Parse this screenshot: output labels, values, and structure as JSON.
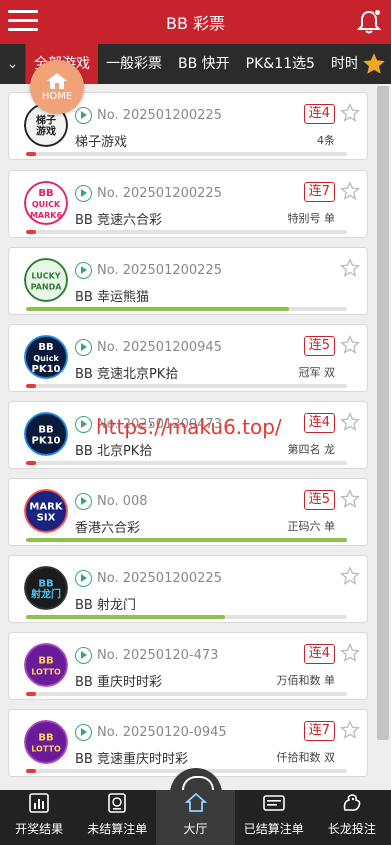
{
  "header": {
    "title": "BB 彩票"
  },
  "categories": [
    "全部游戏",
    "一般彩票",
    "BB 快开",
    "PK&11选5",
    "时时彩"
  ],
  "home": {
    "label": "HOME"
  },
  "watermark": "https://maku6.top/",
  "colors": {
    "brand": "#c8232c",
    "progress_green": "#8bc34a",
    "progress_red": "#e53935"
  },
  "lotteries": [
    {
      "issue": "No. 202501200225",
      "name": "梯子游戏",
      "streak": "连4",
      "result": "4条",
      "progress": 0.03,
      "progress_color": "#e53935",
      "logo": "ladder-game-logo",
      "logo_text": [
        "梯子",
        "游戏"
      ]
    },
    {
      "issue": "No. 202501200225",
      "name": "BB 竞速六合彩",
      "streak": "连7",
      "result": "特别号 单",
      "progress": 0.03,
      "progress_color": "#e53935",
      "logo": "quick-mark6-logo",
      "logo_text": [
        "BB",
        "QUICK",
        "MARK6"
      ]
    },
    {
      "issue": "No. 202501200225",
      "name": "BB 幸运熊猫",
      "streak": "",
      "result": "",
      "progress": 0.82,
      "progress_color": "#8bc34a",
      "logo": "lucky-panda-logo",
      "logo_text": [
        "LUCKY",
        "PANDA"
      ]
    },
    {
      "issue": "No. 202501200945",
      "name": "BB 竞速北京PK拾",
      "streak": "连5",
      "result": "冠军 双",
      "progress": 0.03,
      "progress_color": "#e53935",
      "logo": "quick-pk10-logo",
      "logo_text": [
        "BB",
        "Quick",
        "PK10"
      ]
    },
    {
      "issue": "No. 202501200473",
      "name": "BB 北京PK拾",
      "streak": "连4",
      "result": "第四名 龙",
      "progress": 0.03,
      "progress_color": "#e53935",
      "logo": "pk10-logo",
      "logo_text": [
        "BB",
        "PK10"
      ]
    },
    {
      "issue": "No. 008",
      "name": "香港六合彩",
      "streak": "连5",
      "result": "正码六 单",
      "progress": 1.0,
      "progress_color": "#8bc34a",
      "logo": "mark-six-logo",
      "logo_text": [
        "MARK",
        "SIX"
      ]
    },
    {
      "issue": "No. 202501200225",
      "name": "BB 射龙门",
      "streak": "",
      "result": "",
      "progress": 0.62,
      "progress_color": "#8bc34a",
      "logo": "dragon-gate-logo",
      "logo_text": [
        "BB",
        "射龙门"
      ]
    },
    {
      "issue": "No. 20250120-473",
      "name": "BB 重庆时时彩",
      "streak": "连4",
      "result": "万佰和数 单",
      "progress": 0.03,
      "progress_color": "#e53935",
      "logo": "cq-ssc-logo",
      "logo_text": [
        "BB",
        "LOTTO"
      ]
    },
    {
      "issue": "No. 20250120-0945",
      "name": "BB 竞速重庆时时彩",
      "streak": "连7",
      "result": "仟拾和数 双",
      "progress": 0.03,
      "progress_color": "#e53935",
      "logo": "quick-cq-ssc-logo",
      "logo_text": [
        "BB",
        "LOTTO"
      ]
    }
  ],
  "bottom_nav": [
    {
      "label": "开奖结果",
      "icon": "chart-icon"
    },
    {
      "label": "未结算注单",
      "icon": "pending-bet-icon"
    },
    {
      "label": "大厅",
      "icon": "home-icon"
    },
    {
      "label": "已结算注单",
      "icon": "settled-bet-icon"
    },
    {
      "label": "长龙投注",
      "icon": "dragon-icon"
    }
  ]
}
